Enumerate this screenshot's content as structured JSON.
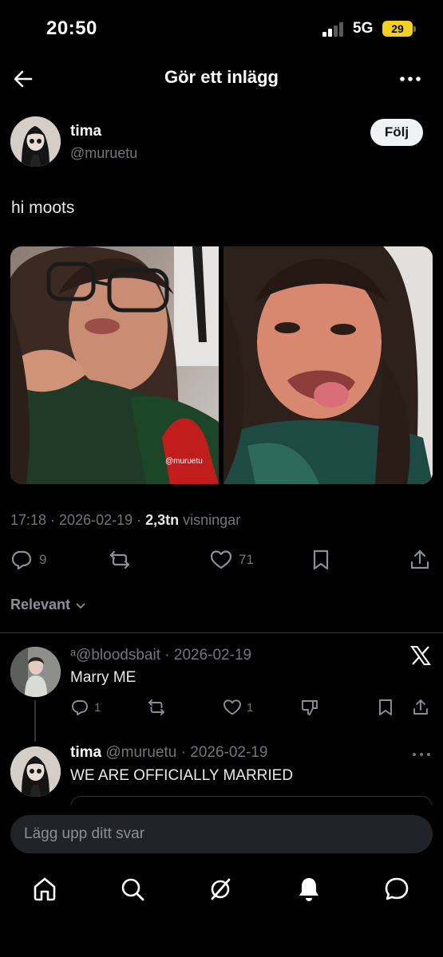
{
  "status_bar": {
    "time": "20:50",
    "network": "5G",
    "battery": "29"
  },
  "header": {
    "title": "Gör ett inlägg"
  },
  "post": {
    "author_name": "tima",
    "author_handle": "@muruetu",
    "follow_label": "Följ",
    "text": "hi moots",
    "media_watermark": "@muruetu",
    "time": "17:18",
    "date": "2026-02-19",
    "views_count": "2,3tn",
    "views_label": "visningar",
    "separator": " · ",
    "stats": {
      "replies": "9",
      "likes": "71"
    }
  },
  "replies_filter": {
    "label": "Relevant"
  },
  "replies": [
    {
      "author_badge": "ᵃ",
      "author_handle": "@bloodsbait",
      "date": "2026-02-19",
      "text": "Marry ME",
      "replies": "1",
      "likes": "1"
    },
    {
      "author_name": "tima",
      "author_handle": "@muruetu",
      "date": "2026-02-19",
      "text": "WE ARE OFFICIALLY MARRIED"
    }
  ],
  "composer": {
    "placeholder": "Lägg upp ditt svar"
  },
  "tab_bar": {
    "items": [
      "home-icon",
      "search-icon",
      "grok-icon",
      "notifications-icon",
      "messages-icon"
    ]
  }
}
